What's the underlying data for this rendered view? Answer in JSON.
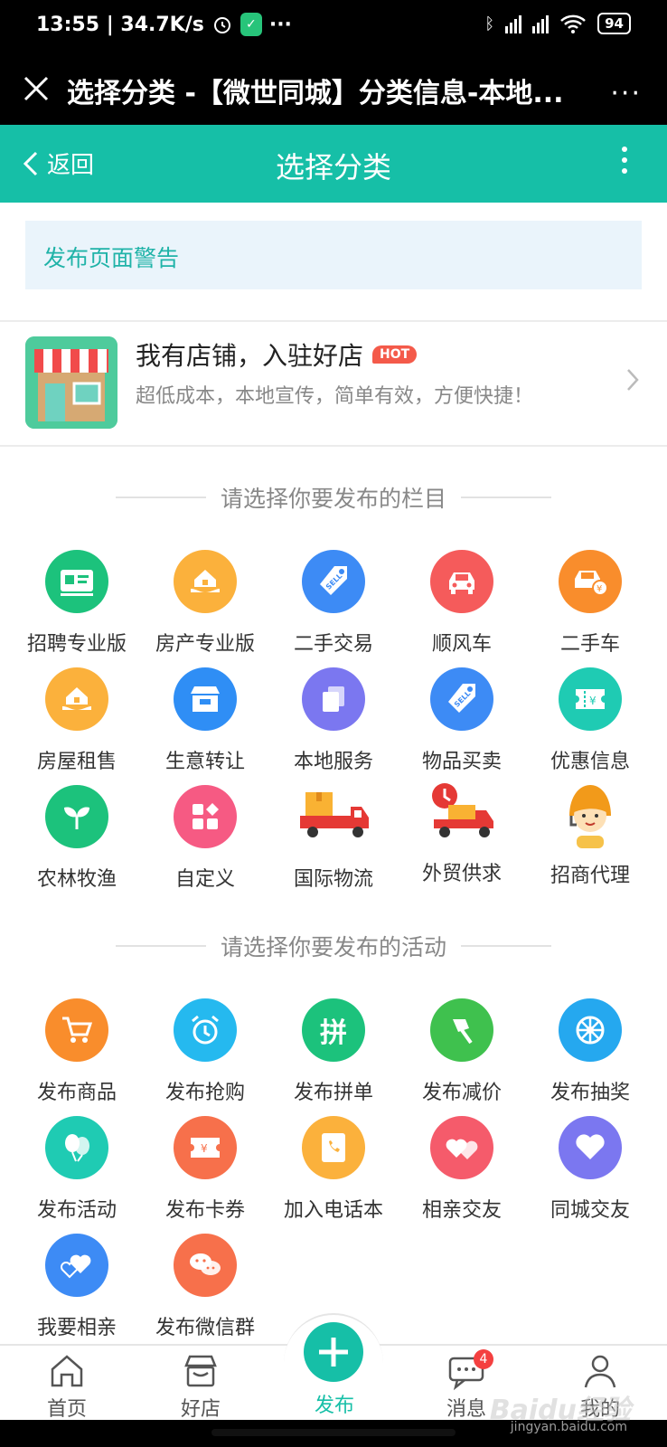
{
  "status_bar": {
    "time_speed": "13:55 | 34.7K/s",
    "battery": "94",
    "more": "···"
  },
  "title_bar": {
    "title": "选择分类 -【微世同城】分类信息-本地...",
    "more": "···"
  },
  "header": {
    "back_label": "返回",
    "title": "选择分类"
  },
  "warning": {
    "text": "发布页面警告"
  },
  "shop": {
    "title": "我有店铺，入驻好店",
    "hot_badge": "HOT",
    "subtitle": "超低成本，本地宣传，简单有效，方便快捷！"
  },
  "sections": {
    "categories_title": "请选择你要发布的栏目",
    "activities_title": "请选择你要发布的活动"
  },
  "categories": [
    {
      "label": "招聘专业版",
      "icon": "id-card-icon",
      "color": "#1cc27c"
    },
    {
      "label": "房产专业版",
      "icon": "house-hand-icon",
      "color": "#fbb13c"
    },
    {
      "label": "二手交易",
      "icon": "sell-tag-icon",
      "color": "#3d8bf5"
    },
    {
      "label": "顺风车",
      "icon": "car-icon",
      "color": "#f55b5b"
    },
    {
      "label": "二手车",
      "icon": "used-car-icon",
      "color": "#f98d2c"
    },
    {
      "label": "房屋租售",
      "icon": "house-hand-icon",
      "color": "#fbb13c"
    },
    {
      "label": "生意转让",
      "icon": "storefront-icon",
      "color": "#2f8ef5"
    },
    {
      "label": "本地服务",
      "icon": "pages-icon",
      "color": "#7b77f0"
    },
    {
      "label": "物品买卖",
      "icon": "sell-tag-icon",
      "color": "#3d8bf5"
    },
    {
      "label": "优惠信息",
      "icon": "coupon-icon",
      "color": "#1fcbb3"
    },
    {
      "label": "农林牧渔",
      "icon": "sprout-icon",
      "color": "#1cc27c"
    },
    {
      "label": "自定义",
      "icon": "grid-custom-icon",
      "color": "#f65a83"
    },
    {
      "label": "国际物流",
      "icon": "delivery-truck-icon",
      "color": ""
    },
    {
      "label": "外贸供求",
      "icon": "fast-truck-icon",
      "color": ""
    },
    {
      "label": "招商代理",
      "icon": "agent-avatar-icon",
      "color": ""
    }
  ],
  "activities": [
    {
      "label": "发布商品",
      "icon": "cart-icon",
      "color": "#f98d2c"
    },
    {
      "label": "发布抢购",
      "icon": "alarm-clock-icon",
      "color": "#25b9ef"
    },
    {
      "label": "发布拼单",
      "icon": "group-buy-icon",
      "color": "#1cc27c"
    },
    {
      "label": "发布减价",
      "icon": "axe-icon",
      "color": "#3fc14e"
    },
    {
      "label": "发布抽奖",
      "icon": "lottery-wheel-icon",
      "color": "#25a8ef"
    },
    {
      "label": "发布活动",
      "icon": "balloons-icon",
      "color": "#1fcbb3"
    },
    {
      "label": "发布卡券",
      "icon": "ticket-icon",
      "color": "#f7704b"
    },
    {
      "label": "加入电话本",
      "icon": "phonebook-icon",
      "color": "#fbb13c"
    },
    {
      "label": "相亲交友",
      "icon": "hearts-icon",
      "color": "#f55b6b"
    },
    {
      "label": "同城交友",
      "icon": "heart-icon",
      "color": "#7b77f0"
    },
    {
      "label": "我要相亲",
      "icon": "couple-hearts-icon",
      "color": "#3d8bf5"
    },
    {
      "label": "发布微信群",
      "icon": "wechat-icon",
      "color": "#f7704b"
    }
  ],
  "bottom_nav": {
    "home": "首页",
    "shops": "好店",
    "publish": "发布",
    "messages": "消息",
    "messages_badge": "4",
    "mine": "我的"
  },
  "watermark": {
    "brand": "Baidu经验",
    "url": "jingyan.baidu.com"
  }
}
